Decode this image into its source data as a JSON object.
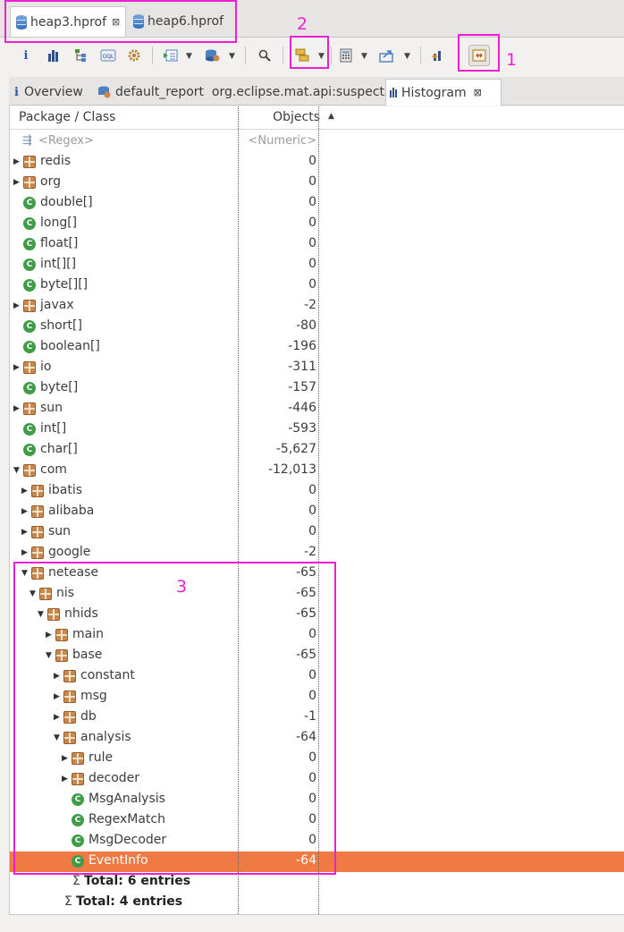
{
  "editor_tabs": [
    {
      "label": "heap3.hprof",
      "close": "⊠",
      "active": true
    },
    {
      "label": "heap6.hprof",
      "active": false
    }
  ],
  "view_tabs": [
    {
      "label": "Overview"
    },
    {
      "label": "default_report  org.eclipse.mat.api:suspects"
    },
    {
      "label": "Histogram",
      "close": "⊠",
      "active": true
    }
  ],
  "columns": {
    "name": "Package / Class",
    "objects": "Objects",
    "sort_indicator": "▲"
  },
  "filter_row": {
    "name": "<Regex>",
    "objects": "<Numeric>"
  },
  "rows": [
    {
      "name": "redis",
      "value": "0",
      "kind": "package",
      "depth": 0,
      "twisty": "collapsed"
    },
    {
      "name": "org",
      "value": "0",
      "kind": "package",
      "depth": 0,
      "twisty": "collapsed"
    },
    {
      "name": "double[]",
      "value": "0",
      "kind": "class",
      "depth": 0,
      "twisty": "none"
    },
    {
      "name": "long[]",
      "value": "0",
      "kind": "class",
      "depth": 0,
      "twisty": "none"
    },
    {
      "name": "float[]",
      "value": "0",
      "kind": "class",
      "depth": 0,
      "twisty": "none"
    },
    {
      "name": "int[][]",
      "value": "0",
      "kind": "class",
      "depth": 0,
      "twisty": "none"
    },
    {
      "name": "byte[][]",
      "value": "0",
      "kind": "class",
      "depth": 0,
      "twisty": "none"
    },
    {
      "name": "javax",
      "value": "-2",
      "kind": "package",
      "depth": 0,
      "twisty": "collapsed"
    },
    {
      "name": "short[]",
      "value": "-80",
      "kind": "class",
      "depth": 0,
      "twisty": "none"
    },
    {
      "name": "boolean[]",
      "value": "-196",
      "kind": "class",
      "depth": 0,
      "twisty": "none"
    },
    {
      "name": "io",
      "value": "-311",
      "kind": "package",
      "depth": 0,
      "twisty": "collapsed"
    },
    {
      "name": "byte[]",
      "value": "-157",
      "kind": "class",
      "depth": 0,
      "twisty": "none"
    },
    {
      "name": "sun",
      "value": "-446",
      "kind": "package",
      "depth": 0,
      "twisty": "collapsed"
    },
    {
      "name": "int[]",
      "value": "-593",
      "kind": "class",
      "depth": 0,
      "twisty": "none"
    },
    {
      "name": "char[]",
      "value": "-5,627",
      "kind": "class",
      "depth": 0,
      "twisty": "none"
    },
    {
      "name": "com",
      "value": "-12,013",
      "kind": "package",
      "depth": 0,
      "twisty": "expanded"
    },
    {
      "name": "ibatis",
      "value": "0",
      "kind": "package",
      "depth": 1,
      "twisty": "collapsed"
    },
    {
      "name": "alibaba",
      "value": "0",
      "kind": "package",
      "depth": 1,
      "twisty": "collapsed"
    },
    {
      "name": "sun",
      "value": "0",
      "kind": "package",
      "depth": 1,
      "twisty": "collapsed"
    },
    {
      "name": "google",
      "value": "-2",
      "kind": "package",
      "depth": 1,
      "twisty": "collapsed"
    },
    {
      "name": "netease",
      "value": "-65",
      "kind": "package",
      "depth": 1,
      "twisty": "expanded"
    },
    {
      "name": "nis",
      "value": "-65",
      "kind": "package",
      "depth": 2,
      "twisty": "expanded"
    },
    {
      "name": "nhids",
      "value": "-65",
      "kind": "package",
      "depth": 3,
      "twisty": "expanded"
    },
    {
      "name": "main",
      "value": "0",
      "kind": "package",
      "depth": 4,
      "twisty": "collapsed"
    },
    {
      "name": "base",
      "value": "-65",
      "kind": "package",
      "depth": 4,
      "twisty": "expanded"
    },
    {
      "name": "constant",
      "value": "0",
      "kind": "package",
      "depth": 5,
      "twisty": "collapsed"
    },
    {
      "name": "msg",
      "value": "0",
      "kind": "package",
      "depth": 5,
      "twisty": "collapsed"
    },
    {
      "name": "db",
      "value": "-1",
      "kind": "package",
      "depth": 5,
      "twisty": "collapsed"
    },
    {
      "name": "analysis",
      "value": "-64",
      "kind": "package",
      "depth": 5,
      "twisty": "expanded"
    },
    {
      "name": "rule",
      "value": "0",
      "kind": "package",
      "depth": 6,
      "twisty": "collapsed"
    },
    {
      "name": "decoder",
      "value": "0",
      "kind": "package",
      "depth": 6,
      "twisty": "collapsed"
    },
    {
      "name": "MsgAnalysis",
      "value": "0",
      "kind": "class",
      "depth": 6,
      "twisty": "none"
    },
    {
      "name": "RegexMatch",
      "value": "0",
      "kind": "class",
      "depth": 6,
      "twisty": "none"
    },
    {
      "name": "MsgDecoder",
      "value": "0",
      "kind": "class",
      "depth": 6,
      "twisty": "none"
    },
    {
      "name": "EventInfo",
      "value": "-64",
      "kind": "class",
      "depth": 6,
      "twisty": "none",
      "selected": true
    },
    {
      "name": "Total: 6 entries",
      "value": "",
      "kind": "total",
      "depth": 6,
      "twisty": "none"
    },
    {
      "name": "Total: 4 entries",
      "value": "",
      "kind": "total",
      "depth": 5,
      "twisty": "none"
    }
  ],
  "annotations": [
    "1",
    "2",
    "3"
  ],
  "colors": {
    "selection": "#f07a43",
    "annotation": "#ee1fd0",
    "package": "#c8874e",
    "class": "#3f9c47"
  }
}
